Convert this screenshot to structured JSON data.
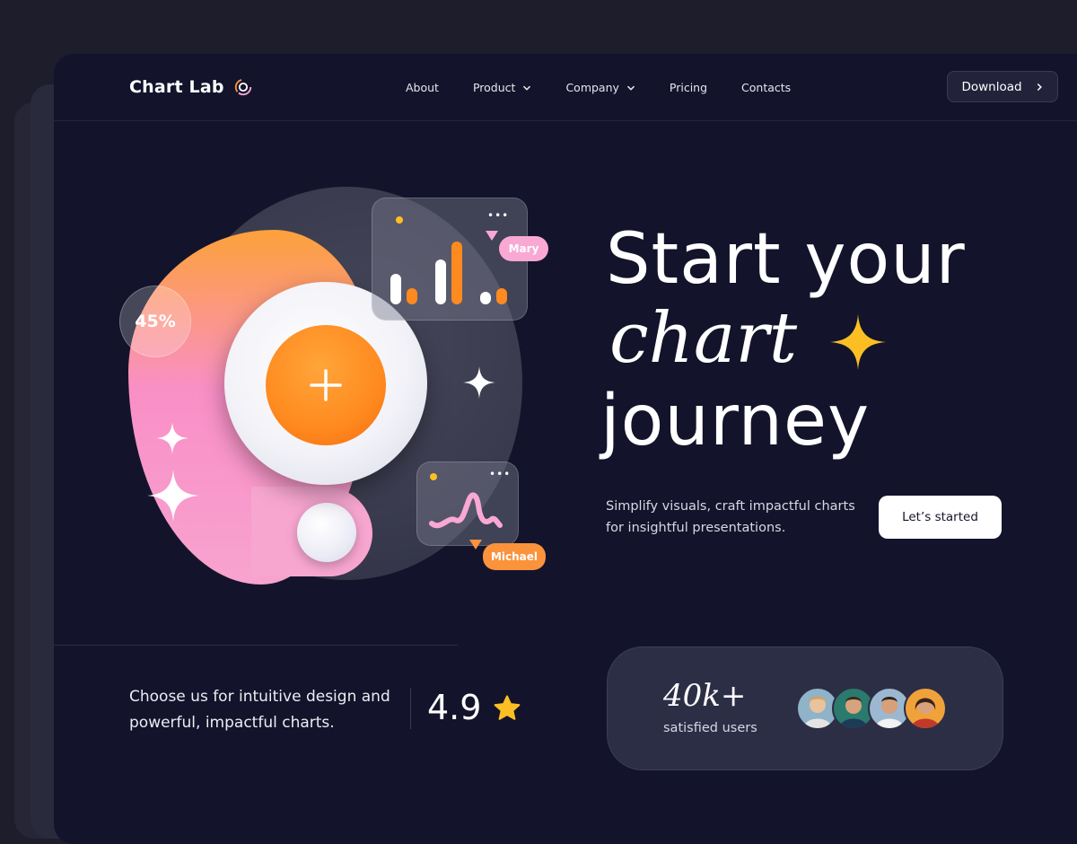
{
  "app": {
    "name": "Chart Lab"
  },
  "nav": {
    "items": [
      {
        "label": "About",
        "has_dropdown": false
      },
      {
        "label": "Product",
        "has_dropdown": true
      },
      {
        "label": "Company",
        "has_dropdown": true
      },
      {
        "label": "Pricing",
        "has_dropdown": false
      },
      {
        "label": "Contacts",
        "has_dropdown": false
      }
    ],
    "download_label": "Download"
  },
  "hero": {
    "headline_line1": "Start your",
    "headline_line2": "chart",
    "headline_line3": "journey",
    "subtitle": "Simplify visuals, craft impactful charts for insightful presentations.",
    "cta_label": "Let’s started",
    "percent_badge": "45%",
    "tag_mary": "Mary",
    "tag_michael": "Michael",
    "card_menu": "•••"
  },
  "bottom": {
    "pitch": "Choose us for intuitive design and powerful, impactful charts.",
    "rating": "4.9",
    "users_count": "40k+",
    "users_label": "satisfied users"
  },
  "colors": {
    "background": "#1d1d2c",
    "frame": "#13142b",
    "orange": "#ff8a1f",
    "pink": "#f9a8d4",
    "yellow": "#fbbf24"
  },
  "icons": [
    "logo-ring-icon",
    "chevron-down-icon",
    "chevron-right-icon",
    "plus-icon",
    "sparkle-icon",
    "star-icon"
  ]
}
